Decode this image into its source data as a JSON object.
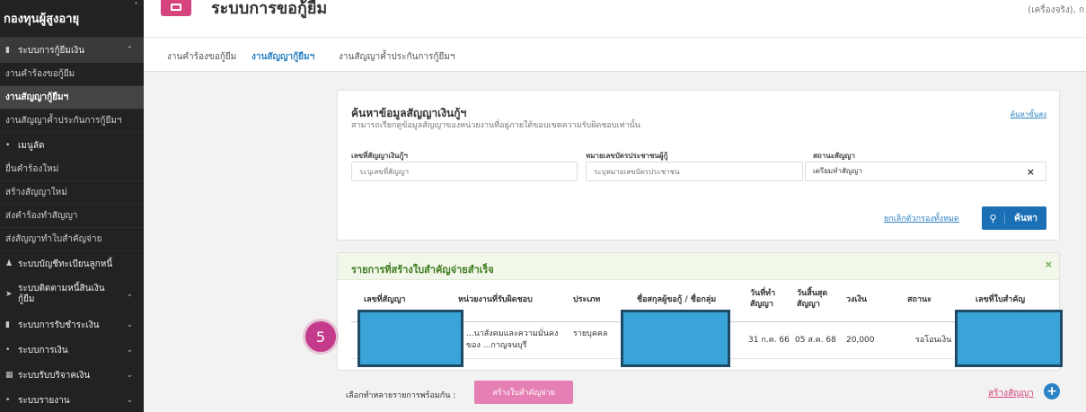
{
  "sidebar": {
    "brand": "กองทุนผู้สูงอายุ",
    "items": [
      {
        "type": "group",
        "label": "ระบบการกู้ยืมเงิน",
        "icon": "document-icon",
        "expanded": true
      },
      {
        "type": "item",
        "label": "งานคำร้องขอกู้ยืม"
      },
      {
        "type": "item",
        "label": "งานสัญญากู้ยืมฯ",
        "active": true
      },
      {
        "type": "item",
        "label": "งานสัญญาค้ำประกันการกู้ยืมฯ"
      },
      {
        "type": "group",
        "label": "เมนูลัด",
        "icon": "bullet-icon"
      },
      {
        "type": "item",
        "label": "ยื่นคำร้องใหม่"
      },
      {
        "type": "item",
        "label": "สร้างสัญญาใหม่"
      },
      {
        "type": "item",
        "label": "ส่งคำร้องทำสัญญา"
      },
      {
        "type": "item",
        "label": "ส่งสัญญาทำใบสำคัญจ่าย"
      },
      {
        "type": "group",
        "label": "ระบบบัญชีทะเบียนลูกหนี้",
        "icon": "users-icon"
      },
      {
        "type": "group",
        "label": "ระบบติดตามหนี้สินเงินกู้ยืม",
        "icon": "arrow-icon"
      },
      {
        "type": "group",
        "label": "ระบบการรับชำระเงิน",
        "icon": "document-icon"
      },
      {
        "type": "group",
        "label": "ระบบการเงิน",
        "icon": "bullet-icon"
      },
      {
        "type": "group",
        "label": "ระบบรับบริจาคเงิน",
        "icon": "table-icon"
      },
      {
        "type": "group",
        "label": "ระบบรายงาน",
        "icon": "bullet-icon"
      }
    ]
  },
  "header": {
    "title": "ระบบการขอกู้ยืม",
    "user": "(เครื่องจริง), ก"
  },
  "tabs": [
    {
      "label": "งานคำร้องขอกู้ยืม",
      "active": false
    },
    {
      "label": "งานสัญญากู้ยืมฯ",
      "active": true
    },
    {
      "label": "งานสัญญาค้ำประกันการกู้ยืมฯ",
      "active": false
    }
  ],
  "search": {
    "title": "ค้นหาข้อมูลสัญญาเงินกู้ฯ",
    "subtitle": "สามารถเรียกดูข้อมูลสัญญาของหน่วยงานที่อยู่ภายใต้ขอบเขตความรับผิดชอบเท่านั้น",
    "advanced_link": "ค้นหาขั้นสูง",
    "fields": {
      "contract_no_label": "เลขที่สัญญาเงินกู้ฯ",
      "contract_no_placeholder": "ระบุเลขที่สัญญา",
      "citizen_id_label": "หมายเลขบัตรประชาชนผู้กู้",
      "citizen_id_placeholder": "ระบุหมายเลขบัตรประชาชน",
      "status_label": "สถานะสัญญา",
      "status_value": "เตรียมทำสัญญา"
    },
    "reset_link": "ยกเลิกตัวกรองทั้งหมด",
    "search_button": "ค้นหา"
  },
  "results": {
    "title": "รายการที่สร้างใบสำคัญจ่ายสำเร็จ",
    "columns": [
      "เลขที่สัญญา",
      "หน่วยงานที่รับผิดชอบ",
      "ประเภท",
      "ชื่อสกุลผู้ขอกู้ / ชื่อกลุ่ม",
      "วันที่ทำสัญญา",
      "วันสิ้นสุดสัญญา",
      "วงเงิน",
      "สถานะ",
      "เลขที่ใบสำคัญ"
    ],
    "rows": [
      {
        "agency": "...นาสังคมและความมั่นคงของ ...กาญจนบุรี",
        "type": "รายบุคคล",
        "start_date": "31 ก.ค. 66",
        "end_date": "05 ส.ค. 68",
        "amount": "20,000",
        "status": "รอโอนเงิน"
      }
    ]
  },
  "step_marker": "5",
  "bulk": {
    "label": "เลือกทำหลายรายการพร้อมกัน :",
    "button": "สร้างใบสำคัญจ่าย"
  },
  "create_link": "สร้างสัญญา",
  "colors": {
    "accent": "#d6447e",
    "primary": "#1a6fb5",
    "success_head": "#f1f7e9",
    "redaction": "#3aa3d8"
  }
}
